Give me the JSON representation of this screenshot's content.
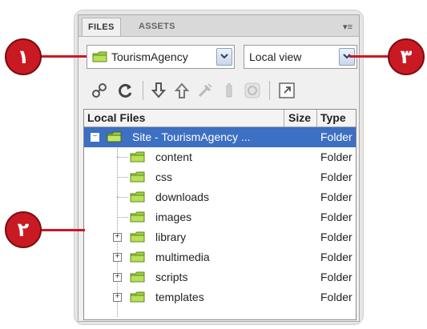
{
  "panel": {
    "tabs": [
      {
        "label": "FILES",
        "active": true
      },
      {
        "label": "ASSETS",
        "active": false
      }
    ],
    "menu_glyph": "▾≡"
  },
  "site_select": {
    "value": "TourismAgency",
    "icon": "folder-icon"
  },
  "view_select": {
    "value": "Local view"
  },
  "toolbar": {
    "buttons": [
      "connect-icon",
      "refresh-icon",
      "get-files-icon",
      "put-files-icon",
      "check-out-icon",
      "check-in-icon",
      "sync-icon",
      "expand-icon"
    ]
  },
  "file_list": {
    "columns": {
      "local": "Local Files",
      "size": "Size",
      "type": "Type"
    },
    "rows": [
      {
        "name": "Site - TourismAgency ...",
        "type": "Folder",
        "selected": true,
        "expander": "−"
      },
      {
        "name": "content",
        "type": "Folder"
      },
      {
        "name": "css",
        "type": "Folder"
      },
      {
        "name": "downloads",
        "type": "Folder"
      },
      {
        "name": "images",
        "type": "Folder"
      },
      {
        "name": "library",
        "type": "Folder",
        "expander": "+"
      },
      {
        "name": "multimedia",
        "type": "Folder",
        "expander": "+"
      },
      {
        "name": "scripts",
        "type": "Folder",
        "expander": "+"
      },
      {
        "name": "templates",
        "type": "Folder",
        "expander": "+"
      }
    ]
  },
  "callouts": [
    "۱",
    "۲",
    "۳"
  ],
  "colors": {
    "callout": "#c91a23",
    "selection": "#3d6fc2",
    "folder": "#8fbf3f"
  }
}
